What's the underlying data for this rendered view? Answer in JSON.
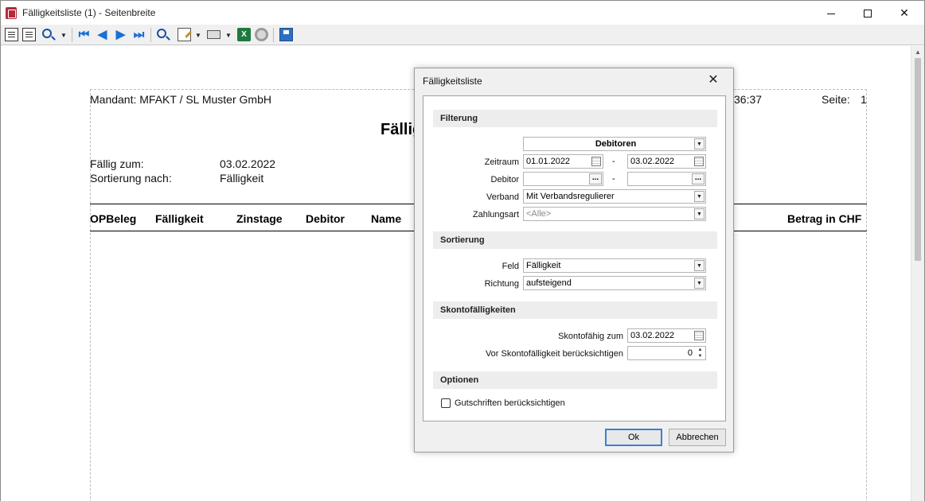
{
  "window": {
    "title": "Fälligkeitsliste (1) - Seitenbreite",
    "minimize": "—",
    "close": "✕"
  },
  "toolbar": {
    "icons": [
      "page-icon",
      "two-pages-icon",
      "zoom-icon",
      "first-page-icon",
      "previous-page-icon",
      "next-page-icon",
      "last-page-icon",
      "search-icon",
      "edit-icon",
      "print-icon",
      "excel-icon",
      "settings-icon",
      "save-icon"
    ]
  },
  "document": {
    "mandant": "Mandant: MFAKT / SL Muster GmbH",
    "time_fragment": "36:37",
    "page_label": "Seite:",
    "page_num_fragment": "1",
    "title_fragment": "Fällig",
    "faellig_label": "Fällig zum:",
    "faellig_value": "03.02.2022",
    "sortierung_label": "Sortierung nach:",
    "sortierung_value": "Fälligkeit",
    "columns": [
      "OPBeleg",
      "Fälligkeit",
      "Zinstage",
      "Debitor",
      "Name",
      "Betrag in CHF"
    ]
  },
  "dialog": {
    "title": "Fälligkeitsliste",
    "close": "✕",
    "filterung": {
      "header": "Filterung",
      "type_select": "Debitoren",
      "zeitraum_label": "Zeitraum",
      "zeitraum_from": "01.01.2022",
      "zeitraum_to": "03.02.2022",
      "range_sep": "-",
      "debitor_label": "Debitor",
      "debitor_from": "",
      "debitor_to": "",
      "browse": "...",
      "verband_label": "Verband",
      "verband_value": "Mit Verbandsregulierer",
      "zahlungsart_label": "Zahlungsart",
      "zahlungsart_value": "<Alle>"
    },
    "sortierung": {
      "header": "Sortierung",
      "feld_label": "Feld",
      "feld_value": "Fälligkeit",
      "richtung_label": "Richtung",
      "richtung_value": "aufsteigend"
    },
    "skonto": {
      "header": "Skontofälligkeiten",
      "skontofaehig_label": "Skontofähig zum",
      "skontofaehig_value": "03.02.2022",
      "vor_label": "Vor Skontofälligkeit berücksichtigen",
      "vor_value": "0"
    },
    "optionen": {
      "header": "Optionen",
      "gutschriften_label": "Gutschriften berücksichtigen",
      "gutschriften_checked": false
    },
    "ok": "Ok",
    "cancel": "Abbrechen"
  }
}
